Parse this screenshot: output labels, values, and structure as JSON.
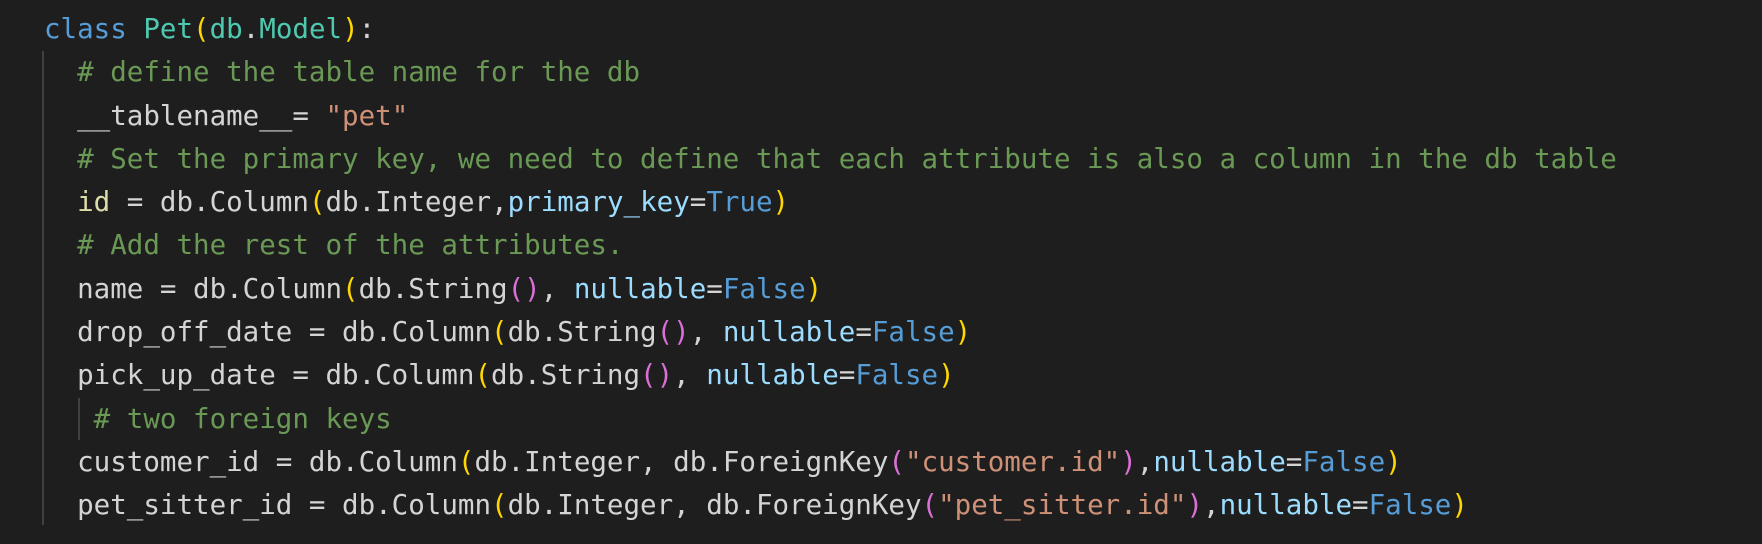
{
  "code": {
    "lines": [
      [
        {
          "t": "class",
          "c": "kw"
        },
        {
          "t": " ",
          "c": "txt"
        },
        {
          "t": "Pet",
          "c": "cls"
        },
        {
          "t": "(",
          "c": "p1"
        },
        {
          "t": "db",
          "c": "cls"
        },
        {
          "t": ".",
          "c": "txt"
        },
        {
          "t": "Model",
          "c": "cls"
        },
        {
          "t": ")",
          "c": "p1"
        },
        {
          "t": ":",
          "c": "txt"
        }
      ],
      [
        {
          "t": "  # define the table name for the db",
          "c": "cmt"
        }
      ],
      [
        {
          "t": "  __tablename__",
          "c": "txt"
        },
        {
          "t": "= ",
          "c": "txt"
        },
        {
          "t": "\"pet\"",
          "c": "str"
        }
      ],
      [
        {
          "t": "  # Set the primary key, we need to define that each attribute is also a column in the db table",
          "c": "cmt"
        }
      ],
      [
        {
          "t": "  ",
          "c": "txt"
        },
        {
          "t": "id",
          "c": "dunder"
        },
        {
          "t": " = db.Column",
          "c": "txt"
        },
        {
          "t": "(",
          "c": "p1"
        },
        {
          "t": "db.Integer,",
          "c": "txt"
        },
        {
          "t": "primary_key",
          "c": "var"
        },
        {
          "t": "=",
          "c": "txt"
        },
        {
          "t": "True",
          "c": "bool"
        },
        {
          "t": ")",
          "c": "p1"
        }
      ],
      [
        {
          "t": "  # Add the rest of the attributes.",
          "c": "cmt"
        }
      ],
      [
        {
          "t": "  name = db.Column",
          "c": "txt"
        },
        {
          "t": "(",
          "c": "p1"
        },
        {
          "t": "db.String",
          "c": "txt"
        },
        {
          "t": "()",
          "c": "p2"
        },
        {
          "t": ", ",
          "c": "txt"
        },
        {
          "t": "nullable",
          "c": "var"
        },
        {
          "t": "=",
          "c": "txt"
        },
        {
          "t": "False",
          "c": "bool"
        },
        {
          "t": ")",
          "c": "p1"
        }
      ],
      [
        {
          "t": "  drop_off_date = db.Column",
          "c": "txt"
        },
        {
          "t": "(",
          "c": "p1"
        },
        {
          "t": "db.String",
          "c": "txt"
        },
        {
          "t": "()",
          "c": "p2"
        },
        {
          "t": ", ",
          "c": "txt"
        },
        {
          "t": "nullable",
          "c": "var"
        },
        {
          "t": "=",
          "c": "txt"
        },
        {
          "t": "False",
          "c": "bool"
        },
        {
          "t": ")",
          "c": "p1"
        }
      ],
      [
        {
          "t": "  pick_up_date = db.Column",
          "c": "txt"
        },
        {
          "t": "(",
          "c": "p1"
        },
        {
          "t": "db.String",
          "c": "txt"
        },
        {
          "t": "()",
          "c": "p2"
        },
        {
          "t": ", ",
          "c": "txt"
        },
        {
          "t": "nullable",
          "c": "var"
        },
        {
          "t": "=",
          "c": "txt"
        },
        {
          "t": "False",
          "c": "bool"
        },
        {
          "t": ")",
          "c": "p1"
        }
      ],
      [
        {
          "t": "   # two foreign keys",
          "c": "cmt"
        }
      ],
      [
        {
          "t": "  customer_id = db.Column",
          "c": "txt"
        },
        {
          "t": "(",
          "c": "p1"
        },
        {
          "t": "db.Integer, db.ForeignKey",
          "c": "txt"
        },
        {
          "t": "(",
          "c": "p2"
        },
        {
          "t": "\"customer.id\"",
          "c": "str"
        },
        {
          "t": ")",
          "c": "p2"
        },
        {
          "t": ",",
          "c": "txt"
        },
        {
          "t": "nullable",
          "c": "var"
        },
        {
          "t": "=",
          "c": "txt"
        },
        {
          "t": "False",
          "c": "bool"
        },
        {
          "t": ")",
          "c": "p1"
        }
      ],
      [
        {
          "t": "  pet_sitter_id = db.Column",
          "c": "txt"
        },
        {
          "t": "(",
          "c": "p1"
        },
        {
          "t": "db.Integer, db.ForeignKey",
          "c": "txt"
        },
        {
          "t": "(",
          "c": "p2"
        },
        {
          "t": "\"pet_sitter.id\"",
          "c": "str"
        },
        {
          "t": ")",
          "c": "p2"
        },
        {
          "t": ",",
          "c": "txt"
        },
        {
          "t": "nullable",
          "c": "var"
        },
        {
          "t": "=",
          "c": "txt"
        },
        {
          "t": "False",
          "c": "bool"
        },
        {
          "t": ")",
          "c": "p1"
        }
      ]
    ]
  },
  "theme": {
    "background": "#1e1e1e",
    "indent_guide": "#404040"
  }
}
